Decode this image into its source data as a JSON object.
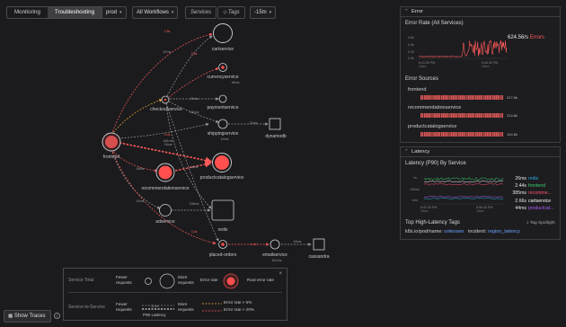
{
  "toolbar": {
    "tabs": [
      "Monitoring",
      "Troubleshooting"
    ],
    "active_tab": "Troubleshooting",
    "environment": "prod",
    "workflows": "All Workflows",
    "services_btn": "Services",
    "tags_btn": "Tags",
    "time_range": "-15m"
  },
  "graph": {
    "nodes": {
      "cartservice": "cartservice",
      "currencyservice": "currencyservice",
      "paymentservice": "paymentservice",
      "checkoutservice": "checkoutservice",
      "shippingservice": "shippingservice",
      "dynamodb": "dynamodb",
      "frontend": "frontend",
      "recommendationservice": "recommendationservice",
      "productcatalogservice": "productcatalogservice",
      "adservice": "adservice",
      "redis": "redis",
      "placed_orders": "placed-orders",
      "emailservice": "emailservice",
      "cassandra": "cassandra"
    },
    "edge_labels": {
      "fe_cart": "2.8s",
      "co_cart": "87ms",
      "co_currency": "2.6s",
      "currency_small": "46ms",
      "co_payment": "20ms",
      "co_shipping": "150ms",
      "shipping_dynamo": "22ms",
      "shipping_small": "10ms",
      "fe_co": "4.0s",
      "fe_ship": "481ms",
      "fe_reco": "16ms",
      "fe_prod": "48ms",
      "reco_prod": "46ms",
      "fe_ad": "44ms",
      "ad_small": "156ms",
      "fe_placed": "3.4s",
      "placed_email": "1.4s",
      "email_cassandra": "64ms",
      "email_small": "621ms"
    }
  },
  "legend": {
    "service_total": "Service Total",
    "service_to_service": "Service-to-Service",
    "fewer_requests": "Fewer requests",
    "more_requests": "More requests",
    "error_rate": "Error rate",
    "root_error_rate": "Root error rate",
    "latency_sample": "11ms",
    "p90_latency": "P90 Latency",
    "error_gt5": "Error rate > 5%",
    "error_gt20": "Error rate > 20%",
    "close": "×"
  },
  "show_traces": "Show Traces",
  "error_panel": {
    "header": "Error",
    "rate_title": "Error Rate (All Services)",
    "y_ticks": [
      "0.6k",
      "0.4k",
      "0.2k",
      "0.0k"
    ],
    "x_ticks": [
      "6:41:30 PM",
      "6:56:30 PM"
    ],
    "x_sub": [
      "10sec",
      "10sec"
    ],
    "rate_value": "624.56/s",
    "rate_unit": "Errors",
    "sources_title": "Error Sources",
    "sources": [
      {
        "name": "frontend",
        "value": "217.6k"
      },
      {
        "name": "recommendationservice",
        "value": "214.8k"
      },
      {
        "name": "productcatalogservice",
        "value": "124.6k"
      }
    ]
  },
  "latency_panel": {
    "header": "Latency",
    "title": "Latency (P90) By Service",
    "y_ticks": [
      "1s",
      "100ms",
      "1ms"
    ],
    "x_ticks": [
      "6:41:30 PM",
      "6:56:30 PM"
    ],
    "x_sub": [
      "10sec",
      "10sec"
    ],
    "services": [
      {
        "value": "26ms",
        "name": "redis",
        "color": "#29a8e0"
      },
      {
        "value": "2.44s",
        "name": "frontend",
        "color": "#3ccf6e"
      },
      {
        "value": "385ms",
        "name": "recomme...",
        "color": "#ff4f6e"
      },
      {
        "value": "2.66s",
        "name": "cartservice",
        "color": "#ffffff"
      },
      {
        "value": "44ms",
        "name": "productcat...",
        "color": "#b45cf0"
      }
    ],
    "tags_title": "Top High-Latency Tags",
    "tag_spotlight": "Tag Spotlight",
    "tags": [
      {
        "key": "k8s.io/pod/name:",
        "value": "unknown"
      },
      {
        "key": "incident:",
        "value": "region_latency"
      }
    ]
  },
  "colors": {
    "error": "#ff4f4f",
    "accent": "#6aa3ff",
    "warn_edge": "#f2a93b"
  }
}
